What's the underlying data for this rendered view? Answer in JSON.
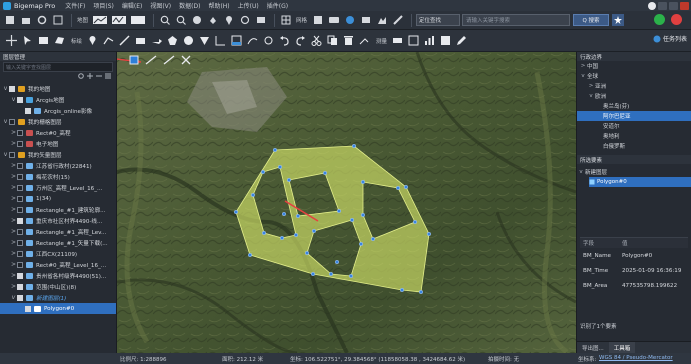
{
  "app": {
    "title": "Bigemap Pro"
  },
  "menus": [
    "文件(F)",
    "项目(S)",
    "编辑(E)",
    "视图(V)",
    "数据(D)",
    "帮助(H)",
    "上传(U)",
    "插件(G)"
  ],
  "toolbar": {
    "map_label": "地图",
    "grid_label": "网格",
    "place_select": "定位查找",
    "search_placeholder": "请输入关键字搜索",
    "search_button": "Q 搜索"
  },
  "draw_toolbar": {
    "mark_label": "标绘",
    "tools_label": "测量",
    "cloud_label": "任务列表"
  },
  "layer_panel": {
    "title": "图层管理",
    "search_placeholder": "输入关键字查找图层",
    "rows": [
      {
        "text": "我的地图",
        "level": 0,
        "expander": "v",
        "checked": true,
        "color": "#e0a020",
        "selected": false,
        "italic": false
      },
      {
        "text": "Arcgis地图",
        "level": 1,
        "expander": "v",
        "checked": true,
        "color": "#4aa3df",
        "selected": false,
        "italic": false
      },
      {
        "text": "Arcgis_online影像",
        "level": 2,
        "expander": "",
        "checked": true,
        "color": "#6fb0e8",
        "selected": false,
        "italic": false
      },
      {
        "text": "我的栅格图层",
        "level": 0,
        "expander": "v",
        "checked": false,
        "color": "#e0a020",
        "selected": false,
        "italic": false
      },
      {
        "text": "Rect#0_高程",
        "level": 1,
        "expander": ">",
        "checked": false,
        "color": "#c85050",
        "selected": false,
        "italic": false
      },
      {
        "text": "电子地图",
        "level": 1,
        "expander": ">",
        "checked": false,
        "color": "#c85050",
        "selected": false,
        "italic": false
      },
      {
        "text": "我的矢量图层",
        "level": 0,
        "expander": "v",
        "checked": false,
        "color": "#e0a020",
        "selected": false,
        "italic": false
      },
      {
        "text": "江苏省行政村(22841)",
        "level": 1,
        "expander": ">",
        "checked": false,
        "color": "#6fb0e8",
        "selected": false,
        "italic": false
      },
      {
        "text": "梅花农村(15)",
        "level": 1,
        "expander": ">",
        "checked": false,
        "color": "#6fb0e8",
        "selected": false,
        "italic": false
      },
      {
        "text": "万州区_高程_Level_16_...",
        "level": 1,
        "expander": ">",
        "checked": false,
        "color": "#6fb0e8",
        "selected": false,
        "italic": false
      },
      {
        "text": "1(34)",
        "level": 1,
        "expander": ">",
        "checked": false,
        "color": "#6fb0e8",
        "selected": false,
        "italic": false
      },
      {
        "text": "Rectangle_#1_建筑轮廓...",
        "level": 1,
        "expander": ">",
        "checked": false,
        "color": "#6fb0e8",
        "selected": false,
        "italic": false
      },
      {
        "text": "重庆市社区村界4490-线...",
        "level": 1,
        "expander": ">",
        "checked": true,
        "color": "#6fb0e8",
        "selected": false,
        "italic": false
      },
      {
        "text": "Rectangle_#1_高程_Lev...",
        "level": 1,
        "expander": ">",
        "checked": false,
        "color": "#6fb0e8",
        "selected": false,
        "italic": false
      },
      {
        "text": "Rectangle_#1_矢量下载(...",
        "level": 1,
        "expander": ">",
        "checked": false,
        "color": "#6fb0e8",
        "selected": false,
        "italic": false
      },
      {
        "text": "江西CX(21109)",
        "level": 1,
        "expander": ">",
        "checked": false,
        "color": "#6fb0e8",
        "selected": false,
        "italic": false
      },
      {
        "text": "Rect#0_高程_Level_16_...",
        "level": 1,
        "expander": ">",
        "checked": false,
        "color": "#6fb0e8",
        "selected": false,
        "italic": false
      },
      {
        "text": "贵州省各村级界4490(51)...",
        "level": 1,
        "expander": ">",
        "checked": true,
        "color": "#6fb0e8",
        "selected": false,
        "italic": false
      },
      {
        "text": "范围(中山区)(8)",
        "level": 1,
        "expander": ">",
        "checked": true,
        "color": "#6fb0e8",
        "selected": false,
        "italic": false
      },
      {
        "text": "新建图层(1)",
        "level": 1,
        "expander": "v",
        "checked": true,
        "color": "#6fb0e8",
        "selected": false,
        "italic": true
      },
      {
        "text": "Polygon#0",
        "level": 2,
        "expander": "",
        "checked": true,
        "color": "#ffffff",
        "selected": true,
        "italic": false
      }
    ]
  },
  "admin_panel": {
    "title": "行政边界",
    "rows": [
      {
        "text": "中国",
        "level": 0,
        "expander": ">",
        "selected": false
      },
      {
        "text": "全球",
        "level": 0,
        "expander": "v",
        "selected": false
      },
      {
        "text": "亚洲",
        "level": 1,
        "expander": ">",
        "selected": false
      },
      {
        "text": "欧洲",
        "level": 1,
        "expander": "v",
        "selected": false
      },
      {
        "text": "奥兰岛(芬)",
        "level": 2,
        "expander": "",
        "selected": false
      },
      {
        "text": "阿尔巴尼亚",
        "level": 2,
        "expander": "",
        "selected": true
      },
      {
        "text": "安道尔",
        "level": 2,
        "expander": "",
        "selected": false
      },
      {
        "text": "奥地利",
        "level": 2,
        "expander": "",
        "selected": false
      },
      {
        "text": "白俄罗斯",
        "level": 2,
        "expander": "",
        "selected": false
      }
    ]
  },
  "selection_panel": {
    "title": "所选要素",
    "layer_name": "新建图层",
    "feature_name": "Polygon#0",
    "col_field": "字段",
    "col_value": "值",
    "attributes": [
      {
        "key": "BM_Name",
        "value": "Polygon#0"
      },
      {
        "key": "BM_Time",
        "value": "2025-01-09 16:36:19"
      },
      {
        "key": "BM_Area",
        "value": "477535798.199622"
      }
    ],
    "selected_count": "识别了1个要素",
    "tabs": [
      "导出图...",
      "工具箱"
    ]
  },
  "status": {
    "scale": "比例尺: 1:288896",
    "area": "面积: 212.12 米",
    "coords": "坐标: 106.522751°, 29.384568°  (11858058.38 , 3424684.62 米)",
    "elevation": "拍摄时间: 无",
    "coord_label": "坐标系:",
    "projection": "WGS 84 / Pseudo-Mercator"
  }
}
